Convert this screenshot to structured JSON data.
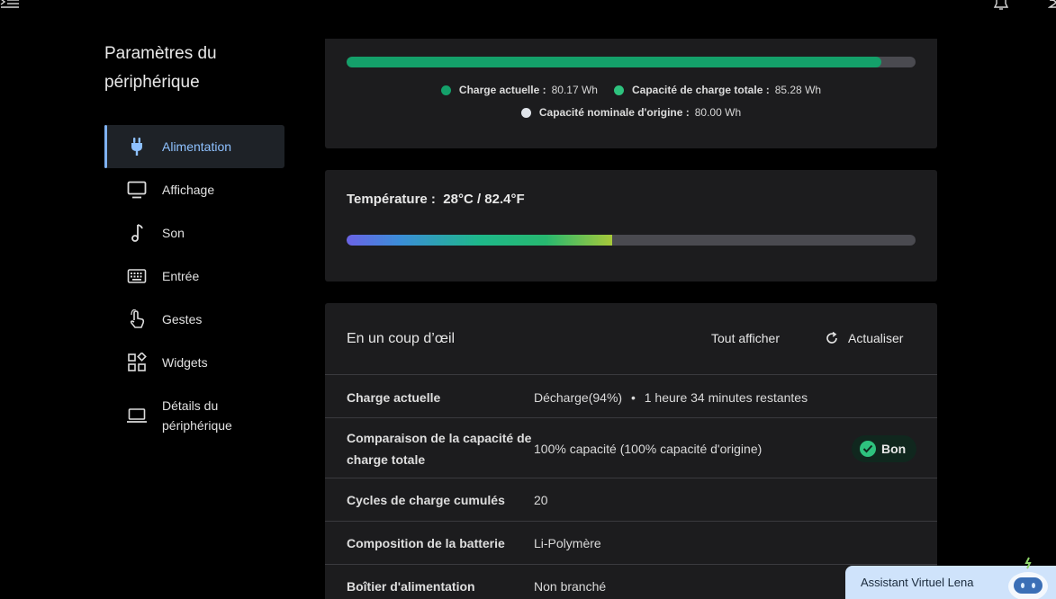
{
  "sidebar": {
    "title": "Paramètres du périphérique",
    "items": [
      {
        "label": "Alimentation",
        "icon": "power-plug-icon",
        "active": true
      },
      {
        "label": "Affichage",
        "icon": "monitor-icon"
      },
      {
        "label": "Son",
        "icon": "music-note-icon"
      },
      {
        "label": "Entrée",
        "icon": "keyboard-icon"
      },
      {
        "label": "Gestes",
        "icon": "touch-gesture-icon"
      },
      {
        "label": "Widgets",
        "icon": "widgets-icon"
      },
      {
        "label": "Détails du périphérique",
        "icon": "laptop-icon"
      }
    ]
  },
  "capacity": {
    "fill_fraction": 0.94,
    "legend": [
      {
        "label": "Charge actuelle :",
        "value": "80.17 Wh",
        "color": "#14a06a"
      },
      {
        "label": "Capacité de charge totale :",
        "value": "85.28 Wh",
        "color": "#2ec27e"
      },
      {
        "label": "Capacité nominale d'origine :",
        "value": "80.00 Wh",
        "color": "#e0e4ea"
      }
    ]
  },
  "temperature": {
    "label": "Température :",
    "value": "28°C / 82.4°F",
    "fill_fraction": 0.466
  },
  "glance": {
    "title": "En un coup d’œil",
    "show_all": "Tout afficher",
    "refresh": "Actualiser",
    "rows": [
      {
        "label": "Charge actuelle",
        "value": "Décharge(94%)",
        "extra": "1 heure 34 minutes restantes"
      },
      {
        "label": "Comparaison de la capacité de charge totale",
        "value": "100% capacité (100% capacité d'origine)",
        "badge": "Bon"
      },
      {
        "label": "Cycles de charge cumulés",
        "value": "20"
      },
      {
        "label": "Composition de la batterie",
        "value": "Li-Polymère"
      },
      {
        "label": "Boîtier d'alimentation",
        "value": "Non branché"
      }
    ]
  },
  "assistant": {
    "label": "Assistant Virtuel Lena"
  },
  "colors": {
    "accent": "#8ec1ff",
    "good": "#2ec27e",
    "card": "#1c1c1e"
  }
}
